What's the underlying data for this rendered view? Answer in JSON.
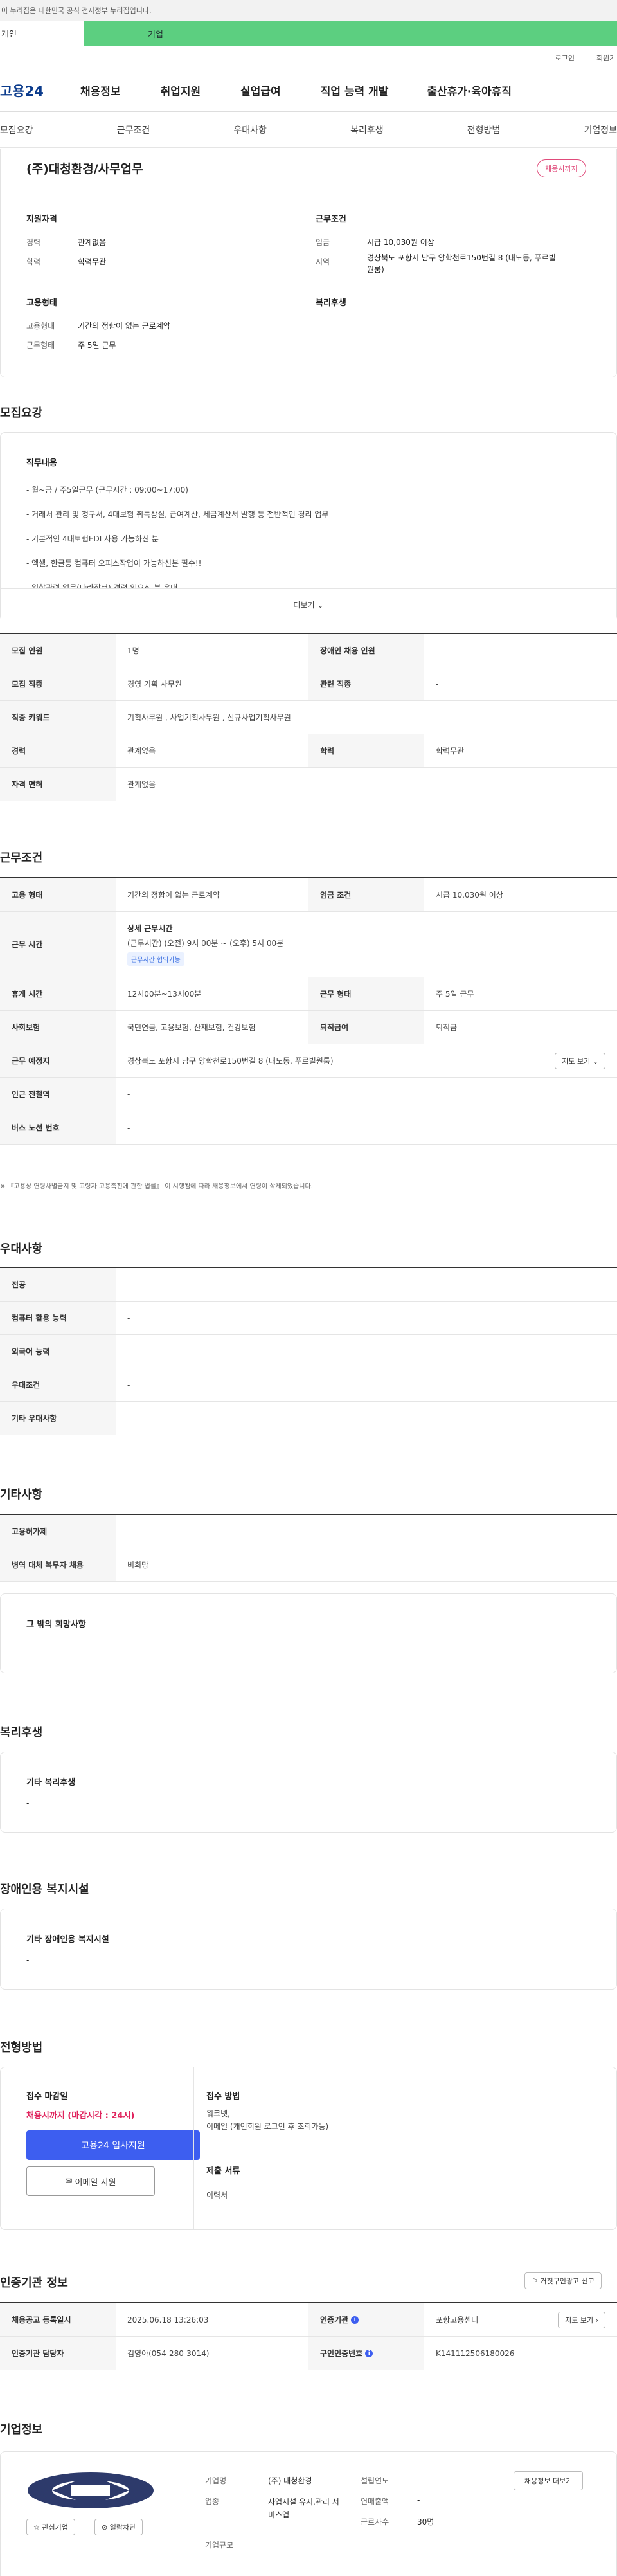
{
  "gov_banner": "이 누리집은 대한민국 공식 전자정부 누리집입니다.",
  "top_tabs": {
    "personal": "개인",
    "corp": "기업"
  },
  "util": {
    "login": "로그인",
    "signup": "회원가입"
  },
  "gnb": {
    "logo": "고용24",
    "menu": [
      "채용정보",
      "취업지원",
      "실업급여",
      "직업 능력 개발",
      "출산휴가·육아휴직"
    ]
  },
  "subnav": [
    "모집요강",
    "근무조건",
    "우대사항",
    "복리후생",
    "전형방법",
    "기업정보"
  ],
  "summary": {
    "company": "(주)대청환경/사무업무",
    "badge": "채용시까지",
    "qual_title": "지원자격",
    "career_label": "경력",
    "career": "관계없음",
    "edu_label": "학력",
    "edu": "학력무관",
    "emp_title": "고용형태",
    "emp_label": "고용형태",
    "emp": "기간의 정함이 없는 근로계약",
    "work_label": "근무형태",
    "work": "주 5일 근무",
    "cond_title": "근무조건",
    "wage_label": "임금",
    "wage": "시급 10,030원 이상",
    "region_label": "지역",
    "region": "경상북도 포항시 남구 양학천로150번길 8 (대도동, 푸르빌원룸)",
    "welfare_title": "복리후생"
  },
  "recruit": {
    "title": "모집요강",
    "duty_title": "직무내용",
    "duties": [
      "- 월~금 / 주5일근무 (근무시간 : 09:00~17:00)",
      "- 거래처 관리 및 청구서, 4대보험 취득상실, 급여계산, 세금계산서 발행 등 전반적인 경리 업무",
      "- 기본적인 4대보험EDI 사용 가능하신 분",
      "- 엑셀, 한글등 컴퓨터 오피스작업이 가능하신분 필수!!",
      "- 입찰관련 업무(나라장터) 경력 있으신 분 우대"
    ],
    "more": "더보기",
    "rows": {
      "count_l": "모집 인원",
      "count": "1명",
      "disabled_l": "장애인 채용 인원",
      "disabled": "-",
      "job_l": "모집 직종",
      "job": "경영 기획 사무원",
      "related_l": "관련 직종",
      "related": "-",
      "kw_l": "직종 키워드",
      "kw": "기획사무원 , 사업기획사무원 , 신규사업기획사무원",
      "career_l": "경력",
      "career": "관계없음",
      "edu_l": "학력",
      "edu": "학력무관",
      "license_l": "자격 면허",
      "license": "관계없음"
    }
  },
  "cond": {
    "title": "근무조건",
    "emp_l": "고용 형태",
    "emp": "기간의 정함이 없는 근로계약",
    "wage_l": "임금 조건",
    "wage": "시급 10,030원 이상",
    "time_l": "근무 시간",
    "time_title": "상세 근무시간",
    "time": "(근무시간) (오전) 9시 00분 ~ (오후) 5시 00분",
    "time_tag": "근무시간 협의가능",
    "rest_l": "휴게 시간",
    "rest": "12시00분~13시00분",
    "work_l": "근무 형태",
    "work": "주 5일 근무",
    "ins_l": "사회보험",
    "ins": "국민연금, 고용보험, 산재보험, 건강보험",
    "sev_l": "퇴직급여",
    "sev": "퇴직금",
    "place_l": "근무 예정지",
    "place": "경상북도 포항시 남구 양학천로150번길 8 (대도동, 푸르빌원룸)",
    "map": "지도 보기",
    "station_l": "인근 전철역",
    "station": "-",
    "bus_l": "버스 노선 번호",
    "bus": "-",
    "note": "※ 『고용상 연령차별금지 및 고령자 고용촉진에 관한 법률』 이 시행됨에 따라 채용정보에서 연령이 삭제되었습니다."
  },
  "pref": {
    "title": "우대사항",
    "rows": [
      [
        "전공",
        "-"
      ],
      [
        "컴퓨터 활용 능력",
        "-"
      ],
      [
        "외국어 능력",
        "-"
      ],
      [
        "우대조건",
        "-"
      ],
      [
        "기타 우대사항",
        "-"
      ]
    ]
  },
  "etc": {
    "title": "기타사항",
    "rows": [
      [
        "고용허가제",
        "-"
      ],
      [
        "병역 대체 복무자 채용",
        "비희망"
      ]
    ],
    "wish_title": "그 밖의 희망사항",
    "wish": "-"
  },
  "welfare": {
    "title": "복리후생",
    "sub": "기타 복리후생",
    "val": "-"
  },
  "disability": {
    "title": "장애인용 복지시설",
    "sub": "기타 장애인용 복지시설",
    "val": "-"
  },
  "apply": {
    "title": "전형방법",
    "deadline_l": "접수 마감일",
    "deadline": "채용시까지 (마감시각 : 24시)",
    "apply_btn": "고용24 입사지원",
    "email_btn": "이메일 지원",
    "method_l": "접수 방법",
    "method": "워크넷,\n이메일 (개인회원 로그인 후 조회가능)",
    "docs_l": "제출 서류",
    "docs": "이력서"
  },
  "agency": {
    "title": "인증기관 정보",
    "report": "거짓구인광고 신고",
    "reg_l": "채용공고 등록일시",
    "reg": "2025.06.18 13:26:03",
    "org_l": "인증기관",
    "org": "포항고용센터",
    "map": "지도 보기",
    "mgr_l": "인증기관 담당자",
    "mgr": "김영아(054-280-3014)",
    "no_l": "구인인증번호",
    "no": "K141112506180026"
  },
  "company": {
    "title": "기업정보",
    "name_l": "기업명",
    "name": "(주) 대청환경",
    "ind_l": "업종",
    "ind": "사업시설 유지.관리 서비스업",
    "size_l": "기업규모",
    "size": "-",
    "est_l": "설립연도",
    "est": "-",
    "sales_l": "연매출액",
    "sales": "-",
    "emp_l": "근로자수",
    "emp": "30명",
    "fav": "관심기업",
    "block": "열람차단",
    "info_btn": "채용정보 더보기"
  }
}
